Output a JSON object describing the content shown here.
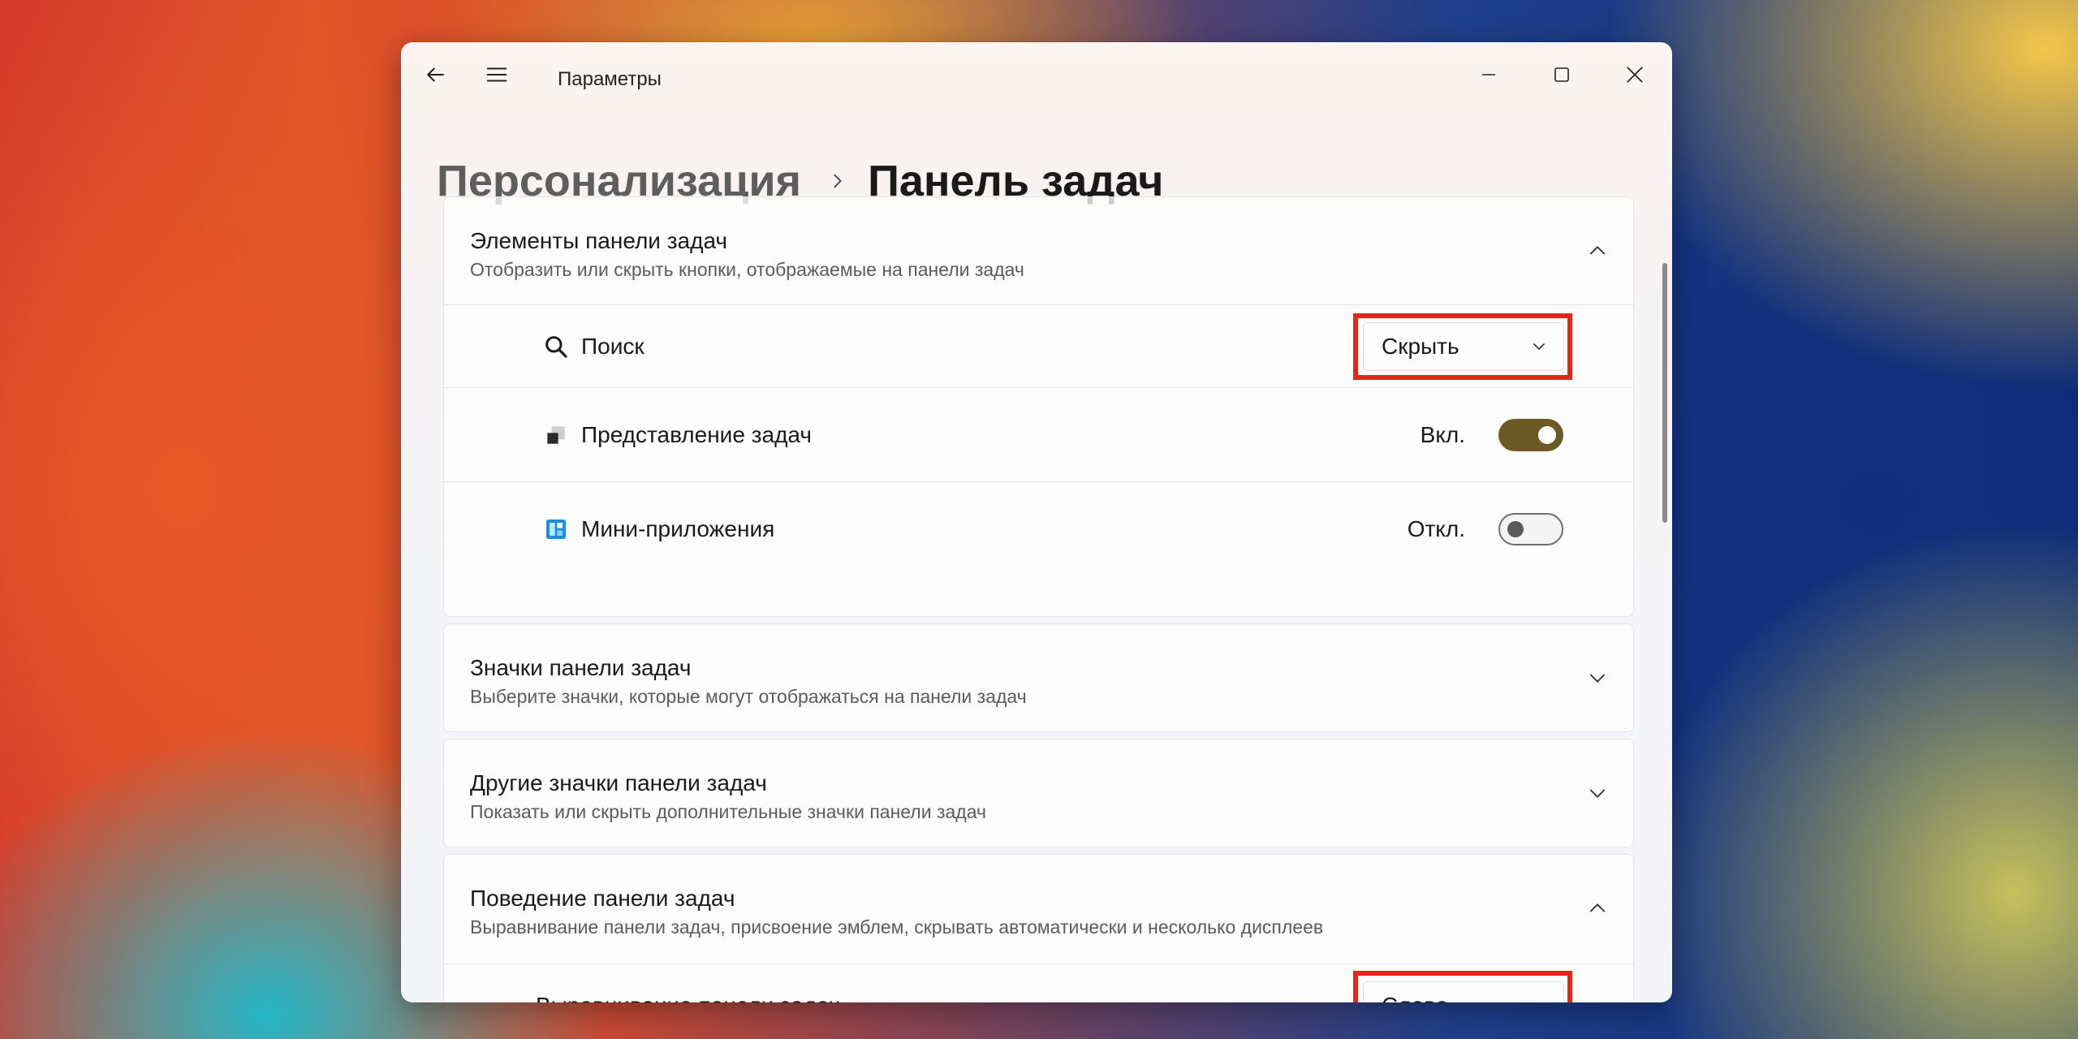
{
  "window": {
    "title": "Параметры",
    "controls": {
      "minimize": "minimize-icon",
      "maximize": "maximize-icon",
      "close": "close-icon"
    }
  },
  "breadcrumb": {
    "parent": "Персонализация",
    "current": "Панель задач"
  },
  "sections": {
    "taskbar_items": {
      "title": "Элементы панели задач",
      "subtitle": "Отобразить или скрыть кнопки, отображаемые на панели задач",
      "expanded": true,
      "rows": {
        "search": {
          "label": "Поиск",
          "icon": "search-icon",
          "value": "Скрыть"
        },
        "task_view": {
          "label": "Представление задач",
          "icon": "task-view-icon",
          "state_label": "Вкл.",
          "on": true
        },
        "widgets": {
          "label": "Мини-приложения",
          "icon": "widgets-icon",
          "state_label": "Откл.",
          "on": false
        }
      }
    },
    "taskbar_icons": {
      "title": "Значки панели задач",
      "subtitle": "Выберите значки, которые могут отображаться на панели задач",
      "expanded": false
    },
    "other_icons": {
      "title": "Другие значки панели задач",
      "subtitle": "Показать или скрыть дополнительные значки панели задач",
      "expanded": false
    },
    "behaviors": {
      "title": "Поведение панели задач",
      "subtitle": "Выравнивание панели задач, присвоение эмблем, скрывать автоматически и несколько дисплеев",
      "expanded": true,
      "rows": {
        "alignment": {
          "label": "Выравнивание панели задач",
          "value": "Слева"
        }
      }
    }
  },
  "colors": {
    "highlight": "#e0281c",
    "toggle_on": "#6b5a24"
  }
}
